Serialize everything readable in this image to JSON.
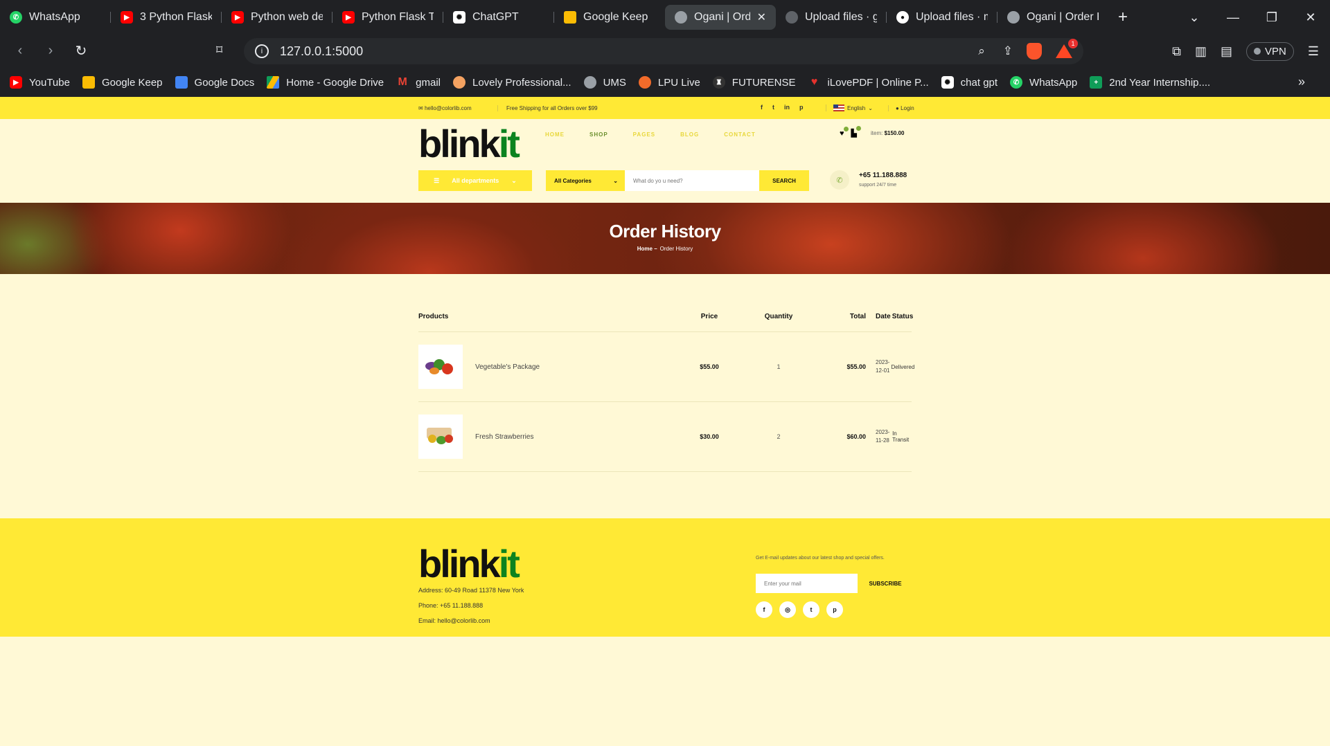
{
  "browser": {
    "tabs": [
      {
        "label": "WhatsApp",
        "icon": "whatsapp-icon"
      },
      {
        "label": "3 Python Flask",
        "icon": "youtube-icon"
      },
      {
        "label": "Python web dev",
        "icon": "youtube-icon"
      },
      {
        "label": "Python Flask Tu",
        "icon": "youtube-icon"
      },
      {
        "label": "ChatGPT",
        "icon": "chatgpt-icon"
      },
      {
        "label": "Google Keep",
        "icon": "google-keep-icon"
      },
      {
        "label": "Ogani | Ord",
        "icon": "globe-icon",
        "active": true
      },
      {
        "label": "Upload files · g",
        "icon": "github-icon"
      },
      {
        "label": "Upload files · m",
        "icon": "github-icon"
      },
      {
        "label": "Ogani | Order H",
        "icon": "globe-icon"
      }
    ],
    "url": "127.0.0.1:5000",
    "vpn_label": "VPN",
    "brave_badge": "1",
    "bookmarks": [
      {
        "label": "YouTube",
        "icon": "youtube-icon"
      },
      {
        "label": "Google Keep",
        "icon": "google-keep-icon"
      },
      {
        "label": "Google Docs",
        "icon": "google-docs-icon"
      },
      {
        "label": "Home - Google Drive",
        "icon": "google-drive-icon"
      },
      {
        "label": "gmail",
        "icon": "gmail-icon"
      },
      {
        "label": "Lovely Professional...",
        "icon": "lpu-icon"
      },
      {
        "label": "UMS",
        "icon": "globe-icon"
      },
      {
        "label": "LPU Live",
        "icon": "lpu-live-icon"
      },
      {
        "label": "FUTURENSE",
        "icon": "futurense-icon"
      },
      {
        "label": "iLovePDF | Online P...",
        "icon": "ilovepdf-icon"
      },
      {
        "label": "chat gpt",
        "icon": "chatgpt-icon"
      },
      {
        "label": "WhatsApp",
        "icon": "whatsapp-icon"
      },
      {
        "label": "2nd Year Internship....",
        "icon": "google-sheets-icon"
      }
    ]
  },
  "site": {
    "topbar": {
      "email": "hello@colorlib.com",
      "shipping": "Free Shipping for all Orders over $99",
      "language": "English",
      "login": "Login"
    },
    "logo": {
      "part1": "blink",
      "part2": "it"
    },
    "menu": [
      "HOME",
      "SHOP",
      "PAGES",
      "BLOG",
      "CONTACT"
    ],
    "active_menu": "SHOP",
    "cart": {
      "item_label": "item:",
      "item_total": "$150.00"
    },
    "departments_label": "All departments",
    "category_label": "All Categories",
    "search_placeholder": "What do yo u need?",
    "search_button": "SEARCH",
    "phone": "+65 11.188.888",
    "support": "support 24/7 time",
    "hero": {
      "title": "Order History",
      "crumb_home": "Home",
      "crumb_current": "Order History"
    },
    "orders": {
      "headers": {
        "products": "Products",
        "price": "Price",
        "quantity": "Quantity",
        "total": "Total",
        "date": "Date",
        "status": "Status"
      },
      "rows": [
        {
          "name": "Vegetable's Package",
          "price": "$55.00",
          "qty": "1",
          "total": "$55.00",
          "date": "2023-12-01",
          "status": "Delivered"
        },
        {
          "name": "Fresh Strawberries",
          "price": "$30.00",
          "qty": "2",
          "total": "$60.00",
          "date": "2023-11-28",
          "status": "In Transit"
        }
      ]
    },
    "footer": {
      "address": "Address: 60-49 Road 11378 New York",
      "phone": "Phone: +65 11.188.888",
      "email": "Email: hello@colorlib.com",
      "newsletter_text": "Get E-mail updates about our latest shop and special offers.",
      "newsletter_placeholder": "Enter your mail",
      "subscribe": "SUBSCRIBE"
    },
    "colors": {
      "accent": "#ffe935",
      "brand_green": "#0c831f",
      "page_bg": "#fff9d6"
    }
  }
}
